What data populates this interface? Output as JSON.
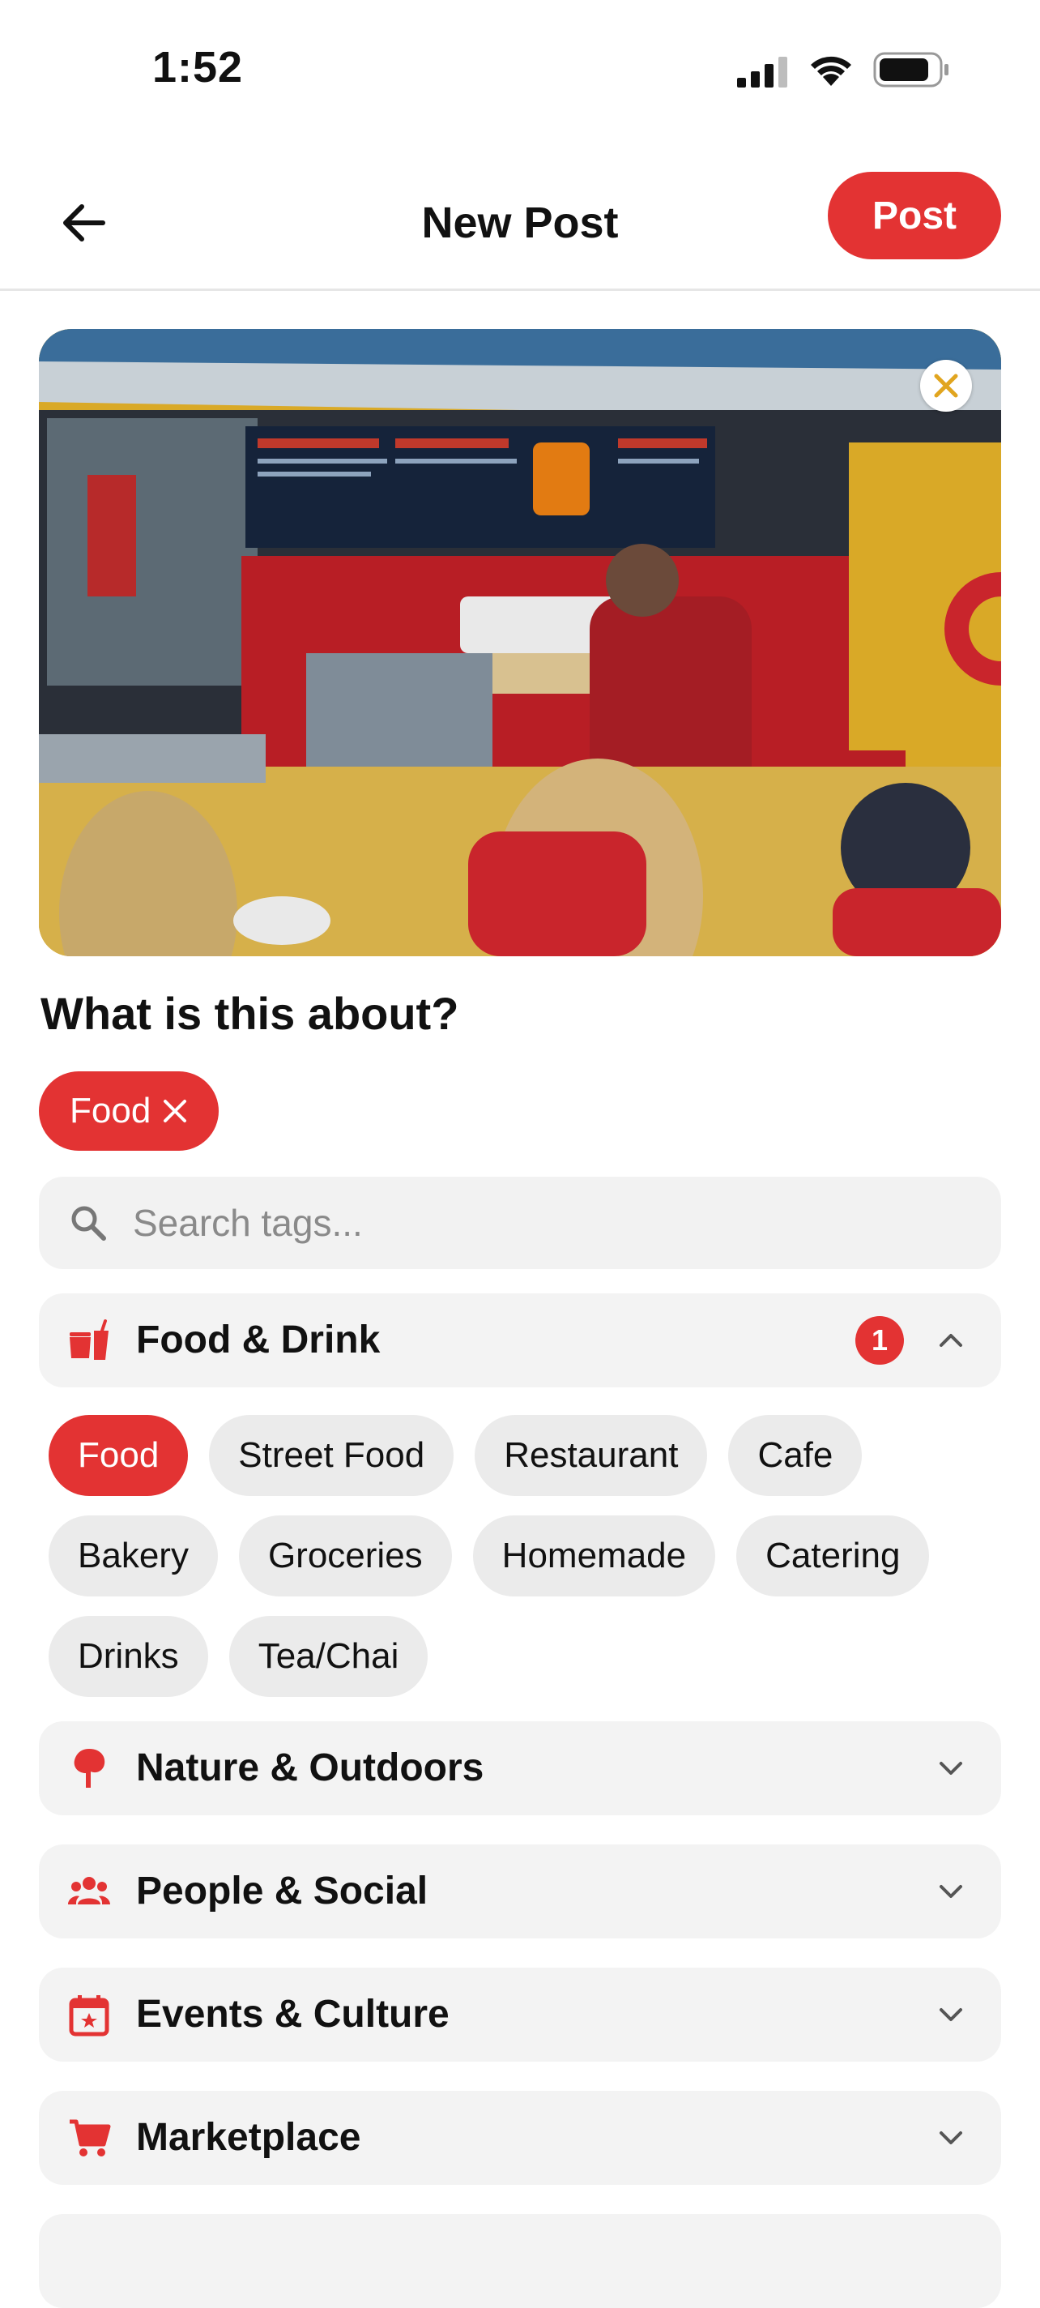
{
  "status_bar": {
    "time": "1:52"
  },
  "nav": {
    "title": "New Post",
    "post_label": "Post"
  },
  "prompt": "What is this about?",
  "selected_tags": [
    {
      "label": "Food"
    }
  ],
  "search": {
    "placeholder": "Search tags...",
    "value": ""
  },
  "categories": [
    {
      "label": "Food & Drink",
      "icon": "fastfood-icon",
      "expanded": true,
      "count": "1",
      "tags": [
        "Food",
        "Street Food",
        "Restaurant",
        "Cafe",
        "Bakery",
        "Groceries",
        "Homemade",
        "Catering",
        "Drinks",
        "Tea/Chai"
      ],
      "selected": [
        "Food"
      ]
    },
    {
      "label": "Nature & Outdoors",
      "icon": "tree-icon",
      "expanded": false
    },
    {
      "label": "People & Social",
      "icon": "people-icon",
      "expanded": false
    },
    {
      "label": "Events & Culture",
      "icon": "calendar-icon",
      "expanded": false
    },
    {
      "label": "Marketplace",
      "icon": "cart-icon",
      "expanded": false
    }
  ],
  "colors": {
    "accent": "#e33333",
    "chip_bg": "#ebebeb",
    "panel_bg": "#f3f3f3"
  }
}
